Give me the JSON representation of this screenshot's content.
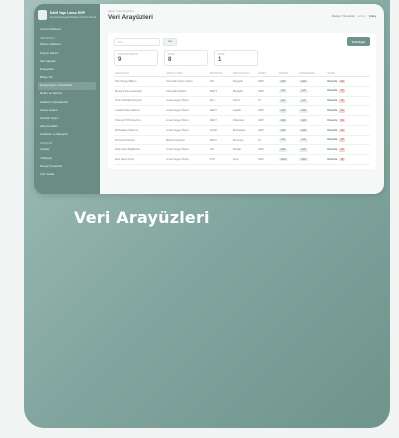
{
  "sidebar": {
    "brand_title": "Kâtif Yapı Lamo ERP",
    "brand_sub": "Kurumsal Kaynak Planlama Yönetim Paneli",
    "sections": [
      {
        "title": "",
        "items": [
          "Kontrol Merkezi"
        ]
      },
      {
        "title": "ANA MODÜL",
        "items": [
          "Sistem Şablonu",
          "Kayıtçı Ekranı",
          "Veri Ajanları",
          "Entegrator",
          "Belge Tur",
          "Entegrasyon Yöneticileri",
          "Roller ve Sürücü",
          "Kullanıcı Operatörleri",
          "Görev Listesi",
          "Günlük Yapısı",
          "Akış Kuralları",
          "Analizler ve Raporlar"
        ]
      },
      {
        "title": "ARAÇLAR",
        "items": [
          "Ayarlar",
          "Yükleyici",
          "Dosya Yöneticisi",
          "Veri Yedek"
        ]
      }
    ],
    "active_index": 6
  },
  "header": {
    "breadcrumb": "Admin / Veri Arayüzleri",
    "title": "Veri Arayüzleri",
    "user_name": "Sistem Yöneticisi",
    "user_role": "admin",
    "logout": "Çıkış"
  },
  "filters": {
    "search_placeholder": "Ara...",
    "filter_label": "Ara",
    "new_button": "Yeni Kayıt"
  },
  "stats": [
    {
      "label": "TOPLAM ARAYÜZ",
      "value": "9"
    },
    {
      "label": "AKTİF",
      "value": "8"
    },
    {
      "label": "PASİF",
      "value": "1"
    }
  ],
  "table": {
    "columns": [
      "ARAYÜZ ADI",
      "ARAYÜZ TÜRÜ",
      "PROTOKOL",
      "VERİ KAYNAĞI",
      "DÜZEY",
      "DURUM",
      "SON EŞLEME",
      "İŞLEM"
    ],
    "rows": [
      [
        "Kök Sayaç Bilişim",
        "Otomatik ölçüm cihazı",
        "API",
        "Sayaçlar",
        "ERP",
        "Aktif"
      ],
      [
        "Mesaj Posta Gateway'i",
        "Otomatik bildirim",
        "MQTT",
        "Mesajlar",
        "ERP",
        "Aktif"
      ],
      [
        "Tartım Baskül Arayüzü",
        "Lineer Eşge Ölçüm",
        "Seri",
        "Tartım",
        "İK",
        "Aktif"
      ],
      [
        "Lojistik Takip Sistemi",
        "Lineer Eşge Ölçüm",
        "REST",
        "Lojistik",
        "ERP",
        "Aktif"
      ],
      [
        "Ödeme POS Arayüzü",
        "Lineer Eşge Ölçüm",
        "REST",
        "Ödemeler",
        "ERP",
        "Aktif"
      ],
      [
        "Muhasebe Aktarımı",
        "Lineer Eşge Ölçüm",
        "SOAP",
        "Muhasebe",
        "ERP",
        "Aktif"
      ],
      [
        "Personel Devam",
        "Bordro Arayüzü",
        "REST",
        "Personel",
        "İK",
        "Aktif"
      ],
      [
        "Stok Depo Bağlantısı",
        "Lineer Eşge Ölçüm",
        "API",
        "Stoklar",
        "ERP",
        "Aktif"
      ],
      [
        "Eski Kayıt Arşivi",
        "Lineer Eşge Ölçüm",
        "FTP",
        "Arşiv",
        "ERP",
        "Pasif"
      ]
    ],
    "action_edit": "Düzenle",
    "action_delete": "Sil"
  },
  "caption": "Veri Arayüzleri"
}
